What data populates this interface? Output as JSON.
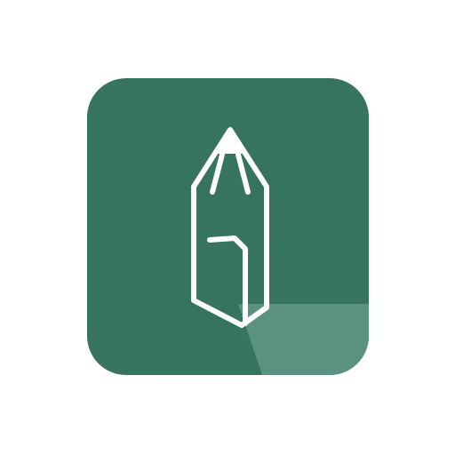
{
  "icon": {
    "name": "pencil-app-icon",
    "colors": {
      "page_background": "#ffffff",
      "tile": "#367460",
      "glyph_stroke": "#ffffff",
      "tile_highlight": "#5a9180"
    },
    "glyph": "pencil-icon"
  }
}
